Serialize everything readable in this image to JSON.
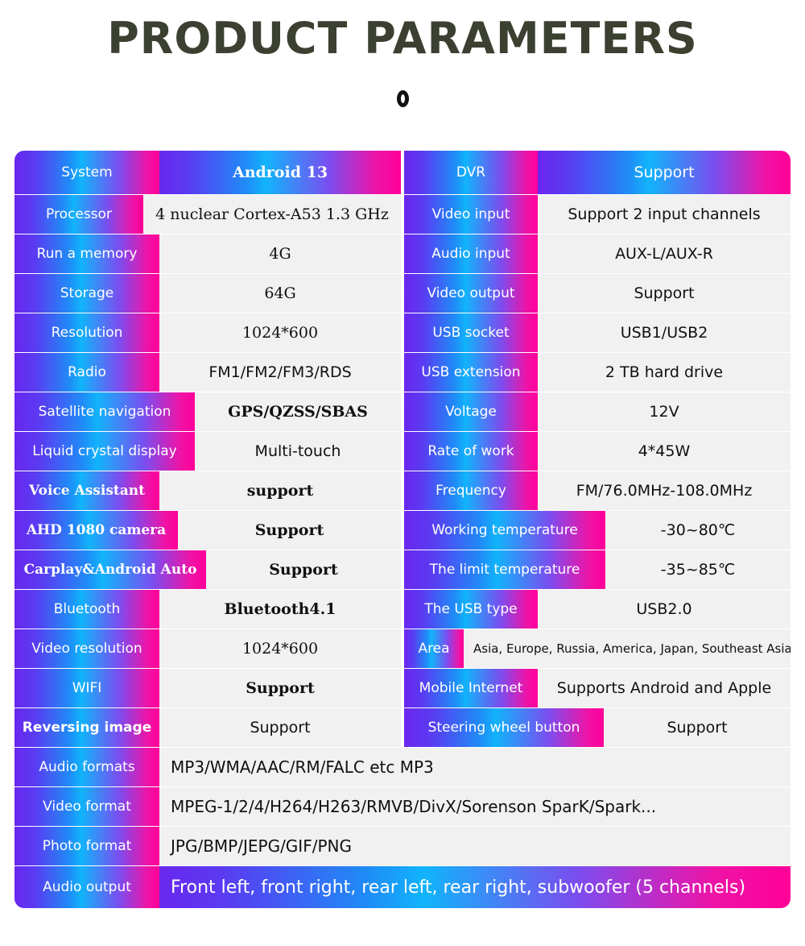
{
  "header": {
    "title": "PRODUCT PARAMETERS",
    "ornament_icon": "ring-icon"
  },
  "colors": {
    "title_text": "#3b4031",
    "gradient_start": "#6a27ef",
    "gradient_mid": "#11b4fb",
    "gradient_end": "#ff0098",
    "value_bg": "#f1f1f1",
    "value_text": "#101010",
    "label_text": "#ffffff"
  },
  "table": {
    "head": {
      "left": {
        "label": "System",
        "value": "Android 13"
      },
      "right": {
        "label": "DVR",
        "value": "Support"
      }
    },
    "rows": [
      {
        "left": {
          "label": "Processor",
          "value": "4 nuclear   Cortex-A53 1.3 GHz"
        },
        "right": {
          "label": "Video input",
          "value": "Support 2 input channels"
        }
      },
      {
        "left": {
          "label": "Run a memory",
          "value": "4G"
        },
        "right": {
          "label": "Audio input",
          "value": "AUX-L/AUX-R"
        }
      },
      {
        "left": {
          "label": "Storage",
          "value": "64G"
        },
        "right": {
          "label": "Video output",
          "value": "Support"
        }
      },
      {
        "left": {
          "label": "Resolution",
          "value": "1024*600"
        },
        "right": {
          "label": "USB socket",
          "value": "USB1/USB2"
        }
      },
      {
        "left": {
          "label": "Radio",
          "value": "FM1/FM2/FM3/RDS"
        },
        "right": {
          "label": "USB extension",
          "value": "2 TB hard drive"
        }
      },
      {
        "left": {
          "label": "Satellite navigation",
          "value": "GPS/QZSS/SBAS"
        },
        "right": {
          "label": "Voltage",
          "value": "12V"
        }
      },
      {
        "left": {
          "label": "Liquid crystal display",
          "value": "Multi-touch"
        },
        "right": {
          "label": "Rate of work",
          "value": "4*45W"
        }
      },
      {
        "left": {
          "label": "Voice Assistant",
          "value": "support"
        },
        "right": {
          "label": "Frequency",
          "value": "FM/76.0MHz-108.0MHz"
        }
      },
      {
        "left": {
          "label": "AHD 1080 camera",
          "value": "Support"
        },
        "right": {
          "label": "Working temperature",
          "value": "-30~80℃"
        }
      },
      {
        "left": {
          "label": "Carplay&Android Auto",
          "value": "Support"
        },
        "right": {
          "label": "The limit temperature",
          "value": "-35~85℃"
        }
      },
      {
        "left": {
          "label": "Bluetooth",
          "value": "Bluetooth4.1"
        },
        "right": {
          "label": "The USB type",
          "value": "USB2.0"
        }
      },
      {
        "left": {
          "label": "Video resolution",
          "value": "1024*600"
        },
        "right": {
          "label": "Area",
          "value": "Asia, Europe, Russia, America, Japan, Southeast Asia"
        }
      },
      {
        "left": {
          "label": "WIFI",
          "value": "Support"
        },
        "right": {
          "label": "Mobile Internet",
          "value": "Supports Android and Apple"
        }
      },
      {
        "left": {
          "label": "Reversing image",
          "value": "Support"
        },
        "right": {
          "label": "Steering wheel button",
          "value": "Support"
        }
      }
    ],
    "full_rows": [
      {
        "label": "Audio formats",
        "value": "MP3/WMA/AAC/RM/FALC etc MP3"
      },
      {
        "label": "Video format",
        "value": "MPEG-1/2/4/H264/H263/RMVB/DivX/Sorenson SparK/Spark..."
      },
      {
        "label": "Photo format",
        "value": "JPG/BMP/JEPG/GIF/PNG"
      }
    ],
    "last_row": {
      "label": "Audio output",
      "value": "Front left, front right, rear left, rear right, subwoofer (5 channels)"
    }
  }
}
